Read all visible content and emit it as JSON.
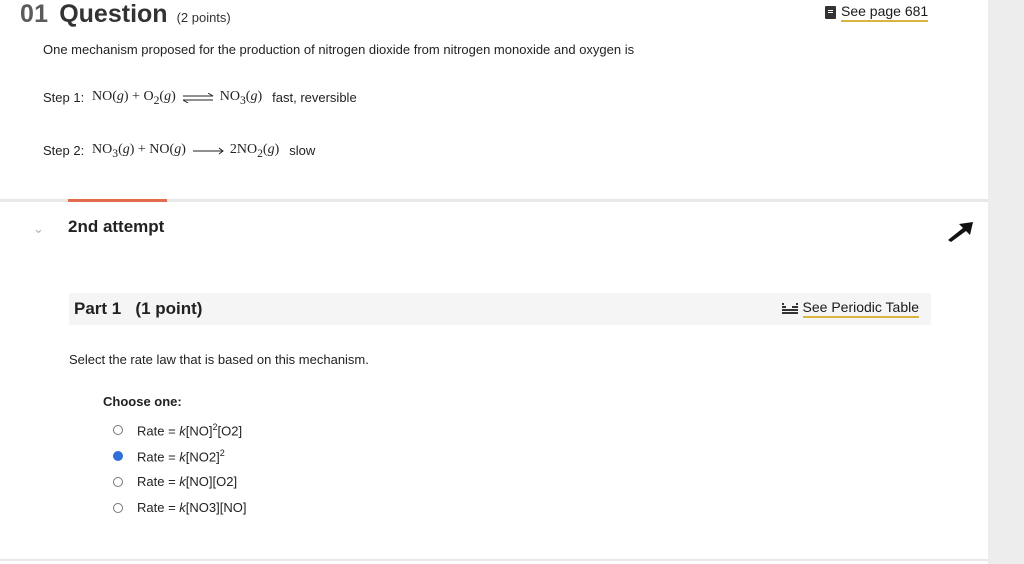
{
  "question": {
    "number": "01",
    "word": "Question",
    "points": "(2 points)",
    "see_page": "See page 681",
    "intro": "One mechanism proposed for the production of nitrogen dioxide from nitrogen monoxide and oxygen is",
    "step1": {
      "label": "Step 1:",
      "r1": "NO(",
      "r1g": "g",
      "r1c": ") + O",
      "r1sub": "2",
      "r1d": "(",
      "r1g2": "g",
      "r1e": ")",
      "p1": "NO",
      "p1sub": "3",
      "p1a": "(",
      "p1g": "g",
      "p1b": ")",
      "note": "fast, reversible"
    },
    "step2": {
      "label": "Step 2:",
      "r1": "NO",
      "r1sub": "3",
      "r1a": "(",
      "r1g": "g",
      "r1b": ") + NO(",
      "r1g2": "g",
      "r1c": ")",
      "p1": "2NO",
      "p1sub": "2",
      "p1a": "(",
      "p1g": "g",
      "p1b": ")",
      "note": "slow"
    }
  },
  "attempt": {
    "label": "2nd attempt"
  },
  "part": {
    "title": "Part 1   (1 point)",
    "periodic": "See Periodic Table",
    "prompt": "Select the rate law that is based on this mechanism.",
    "choose": "Choose one:",
    "options": [
      {
        "pre": "Rate = ",
        "k": "k",
        "body": "[NO]",
        "sup": "2",
        "tail": "[O",
        "sub": "2",
        "end": "]"
      },
      {
        "pre": "Rate = ",
        "k": "k",
        "body": "[NO",
        "sub": "2",
        "mid": "]",
        "sup": "2"
      },
      {
        "pre": "Rate = ",
        "k": "k",
        "body": "[NO][O",
        "sub": "2",
        "end": "]"
      },
      {
        "pre": "Rate = ",
        "k": "k",
        "body": "[NO",
        "sub": "3",
        "end": "][NO]"
      }
    ],
    "selected_index": 1
  },
  "colors": {
    "accent": "#e16b4c",
    "link_underline": "#d9b441",
    "radio_selected": "#2f6fd8"
  }
}
